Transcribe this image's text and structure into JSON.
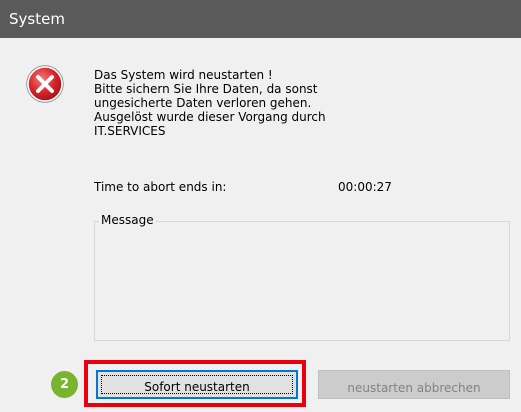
{
  "window": {
    "title": "System"
  },
  "dialog": {
    "icon": "error-icon",
    "message_lines": [
      "Das System wird neustarten !",
      "Bitte sichern Sie Ihre Daten, da sonst",
      "ungesicherte Daten verloren gehen.",
      "Ausgelöst wurde dieser Vorgang durch",
      "IT.SERVICES"
    ],
    "timer_label": "Time to abort ends in:",
    "timer_value": "00:00:27",
    "message_group_label": "Message",
    "message_group_value": ""
  },
  "buttons": {
    "restart_now": "Sofort neustarten",
    "cancel_restart": "neustarten abbrechen"
  },
  "annotation": {
    "badge_number": "2",
    "highlight_color": "#e8000e",
    "badge_color": "#7ab32e"
  }
}
